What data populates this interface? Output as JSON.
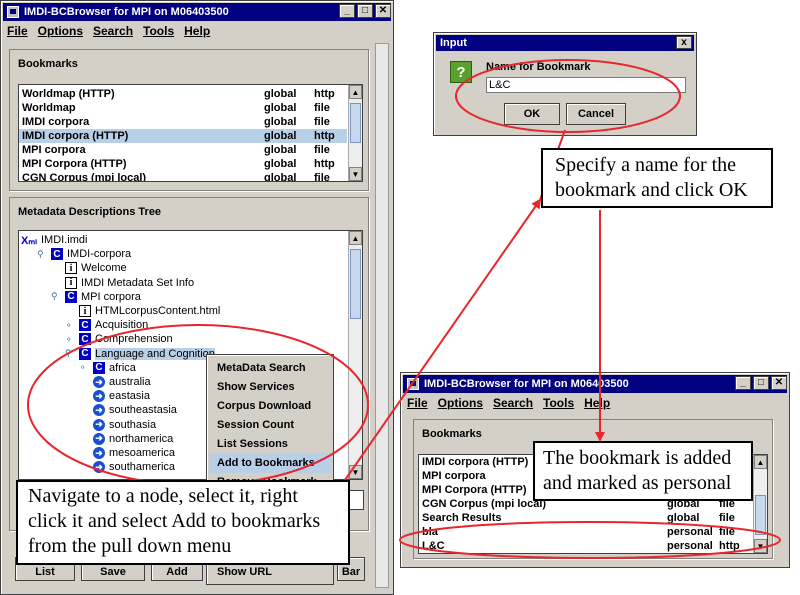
{
  "main_window": {
    "title": "IMDI-BCBrowser for MPI on M06403500",
    "menu": [
      "File",
      "Options",
      "Search",
      "Tools",
      "Help"
    ],
    "bookmarks_title": "Bookmarks",
    "bookmarks": [
      {
        "name": "Worldmap (HTTP)",
        "scope": "global",
        "type": "http"
      },
      {
        "name": "Worldmap",
        "scope": "global",
        "type": "file"
      },
      {
        "name": "IMDI corpora",
        "scope": "global",
        "type": "file"
      },
      {
        "name": "IMDI corpora (HTTP)",
        "scope": "global",
        "type": "http"
      },
      {
        "name": "MPI corpora",
        "scope": "global",
        "type": "file"
      },
      {
        "name": "MPI Corpora (HTTP)",
        "scope": "global",
        "type": "http"
      },
      {
        "name": "CGN Corpus (mpi local)",
        "scope": "global",
        "type": "file"
      }
    ],
    "tree_title": "Metadata Descriptions Tree",
    "tree": [
      {
        "label": "IMDI.imdi",
        "icon": "x",
        "level": 0
      },
      {
        "label": "IMDI-corpora",
        "icon": "c",
        "level": 1
      },
      {
        "label": "Welcome",
        "icon": "i",
        "level": 2
      },
      {
        "label": "IMDI Metadata Set Info",
        "icon": "i",
        "level": 2
      },
      {
        "label": "MPI corpora",
        "icon": "c",
        "level": 2
      },
      {
        "label": "HTMLcorpusContent.html",
        "icon": "i",
        "level": 3
      },
      {
        "label": "Acquisition",
        "icon": "c",
        "level": 3
      },
      {
        "label": "Comprehension",
        "icon": "c",
        "level": 3
      },
      {
        "label": "Language and Cognition",
        "icon": "c",
        "level": 3
      },
      {
        "label": "africa",
        "icon": "c",
        "level": 4
      },
      {
        "label": "australia",
        "icon": "arrow",
        "level": 4
      },
      {
        "label": "eastasia",
        "icon": "arrow",
        "level": 4
      },
      {
        "label": "southeastasia",
        "icon": "arrow",
        "level": 4
      },
      {
        "label": "southasia",
        "icon": "arrow",
        "level": 4
      },
      {
        "label": "northamerica",
        "icon": "arrow",
        "level": 4
      },
      {
        "label": "mesoamerica",
        "icon": "arrow",
        "level": 4
      },
      {
        "label": "southamerica",
        "icon": "arrow",
        "level": 4
      }
    ],
    "toolbar_buttons": [
      "List",
      "Save",
      "Add",
      "Bar"
    ],
    "context_menu": [
      "MetaData Search",
      "Show Services",
      "Corpus Download",
      "Session Count",
      "List Sessions",
      "Add to Bookmarks",
      "Remove Bookmark",
      "",
      "",
      "",
      "Show URL"
    ]
  },
  "input_dialog": {
    "title": "Input",
    "label": "Name for Bookmark",
    "value": "L&C",
    "ok": "OK",
    "cancel": "Cancel",
    "close": "x"
  },
  "second_window": {
    "title": "IMDI-BCBrowser for MPI on M06403500",
    "menu": [
      "File",
      "Options",
      "Search",
      "Tools",
      "Help"
    ],
    "bookmarks_title": "Bookmarks",
    "bookmarks": [
      {
        "name": "IMDI corpora (HTTP)",
        "scope": "global",
        "type": "http"
      },
      {
        "name": "MPI corpora",
        "scope": "global",
        "type": "file"
      },
      {
        "name": "MPI Corpora (HTTP)",
        "scope": "global",
        "type": "http"
      },
      {
        "name": "CGN Corpus (mpi local)",
        "scope": "global",
        "type": "file"
      },
      {
        "name": "Search Results",
        "scope": "global",
        "type": "file"
      },
      {
        "name": "bla",
        "scope": "personal",
        "type": "file"
      },
      {
        "name": "L&C",
        "scope": "personal",
        "type": "http"
      }
    ]
  },
  "annotations": {
    "navigate": [
      "Navigate to a node, select it, right",
      "click it and select Add to bookmarks",
      "from the pull down menu"
    ],
    "specify": [
      "Specify a name for the",
      "bookmark and click OK"
    ],
    "added": [
      "The bookmark is added",
      "and marked as personal"
    ]
  },
  "colors": {
    "titlebar": "#000080",
    "window": "#d4d0c8",
    "selection": "#b8cfe8",
    "annotation_red": "#e8262c"
  }
}
